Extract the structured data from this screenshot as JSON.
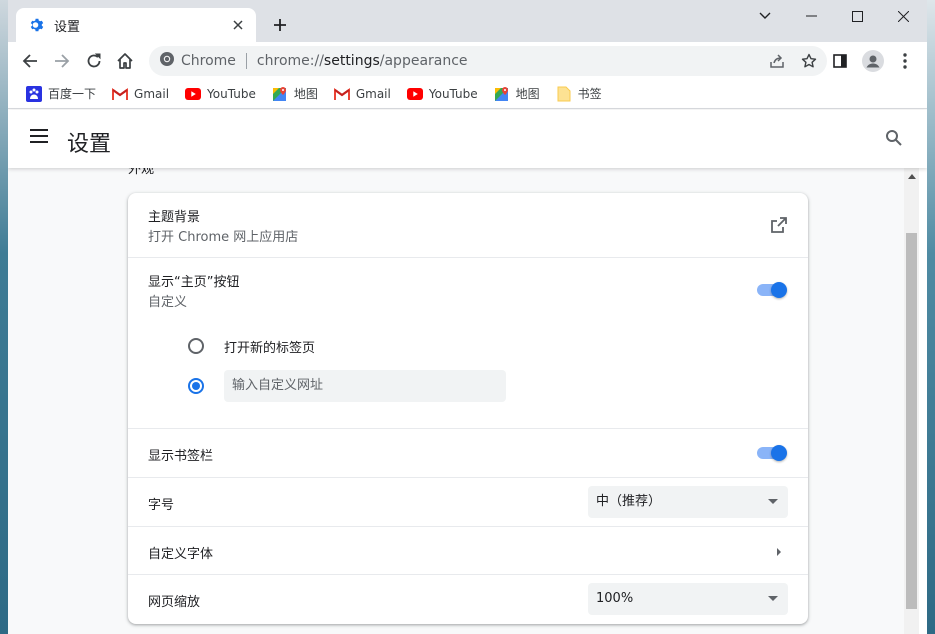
{
  "browser": {
    "tab": {
      "title": "设置",
      "favicon": "gear-icon"
    },
    "omnibox": {
      "site_label": "Chrome",
      "url_scheme": "chrome://",
      "url_host": "settings",
      "url_path": "/appearance"
    }
  },
  "bookmarks": [
    {
      "label": "百度一下",
      "icon": "baidu-icon"
    },
    {
      "label": "Gmail",
      "icon": "gmail-icon"
    },
    {
      "label": "YouTube",
      "icon": "youtube-icon"
    },
    {
      "label": "地图",
      "icon": "maps-icon"
    },
    {
      "label": "Gmail",
      "icon": "gmail-icon"
    },
    {
      "label": "YouTube",
      "icon": "youtube-icon"
    },
    {
      "label": "地图",
      "icon": "maps-icon"
    },
    {
      "label": "书签",
      "icon": "folder-icon"
    }
  ],
  "settings": {
    "title": "设置",
    "section_title": "外观",
    "theme": {
      "label": "主题背景",
      "sub": "打开 Chrome 网上应用店"
    },
    "home_button": {
      "label": "显示“主页”按钮",
      "sub": "自定义",
      "enabled": true,
      "option_new_tab": "打开新的标签页",
      "option_custom_placeholder": "输入自定义网址"
    },
    "bookmarks_bar": {
      "label": "显示书签栏",
      "enabled": true
    },
    "font_size": {
      "label": "字号",
      "value": "中（推荐）"
    },
    "custom_fonts": {
      "label": "自定义字体"
    },
    "page_zoom": {
      "label": "网页缩放",
      "value": "100%"
    }
  },
  "colors": {
    "accent": "#1a73e8",
    "toggle_track": "#8ab4f8",
    "tabstrip": "#dee1e6"
  }
}
